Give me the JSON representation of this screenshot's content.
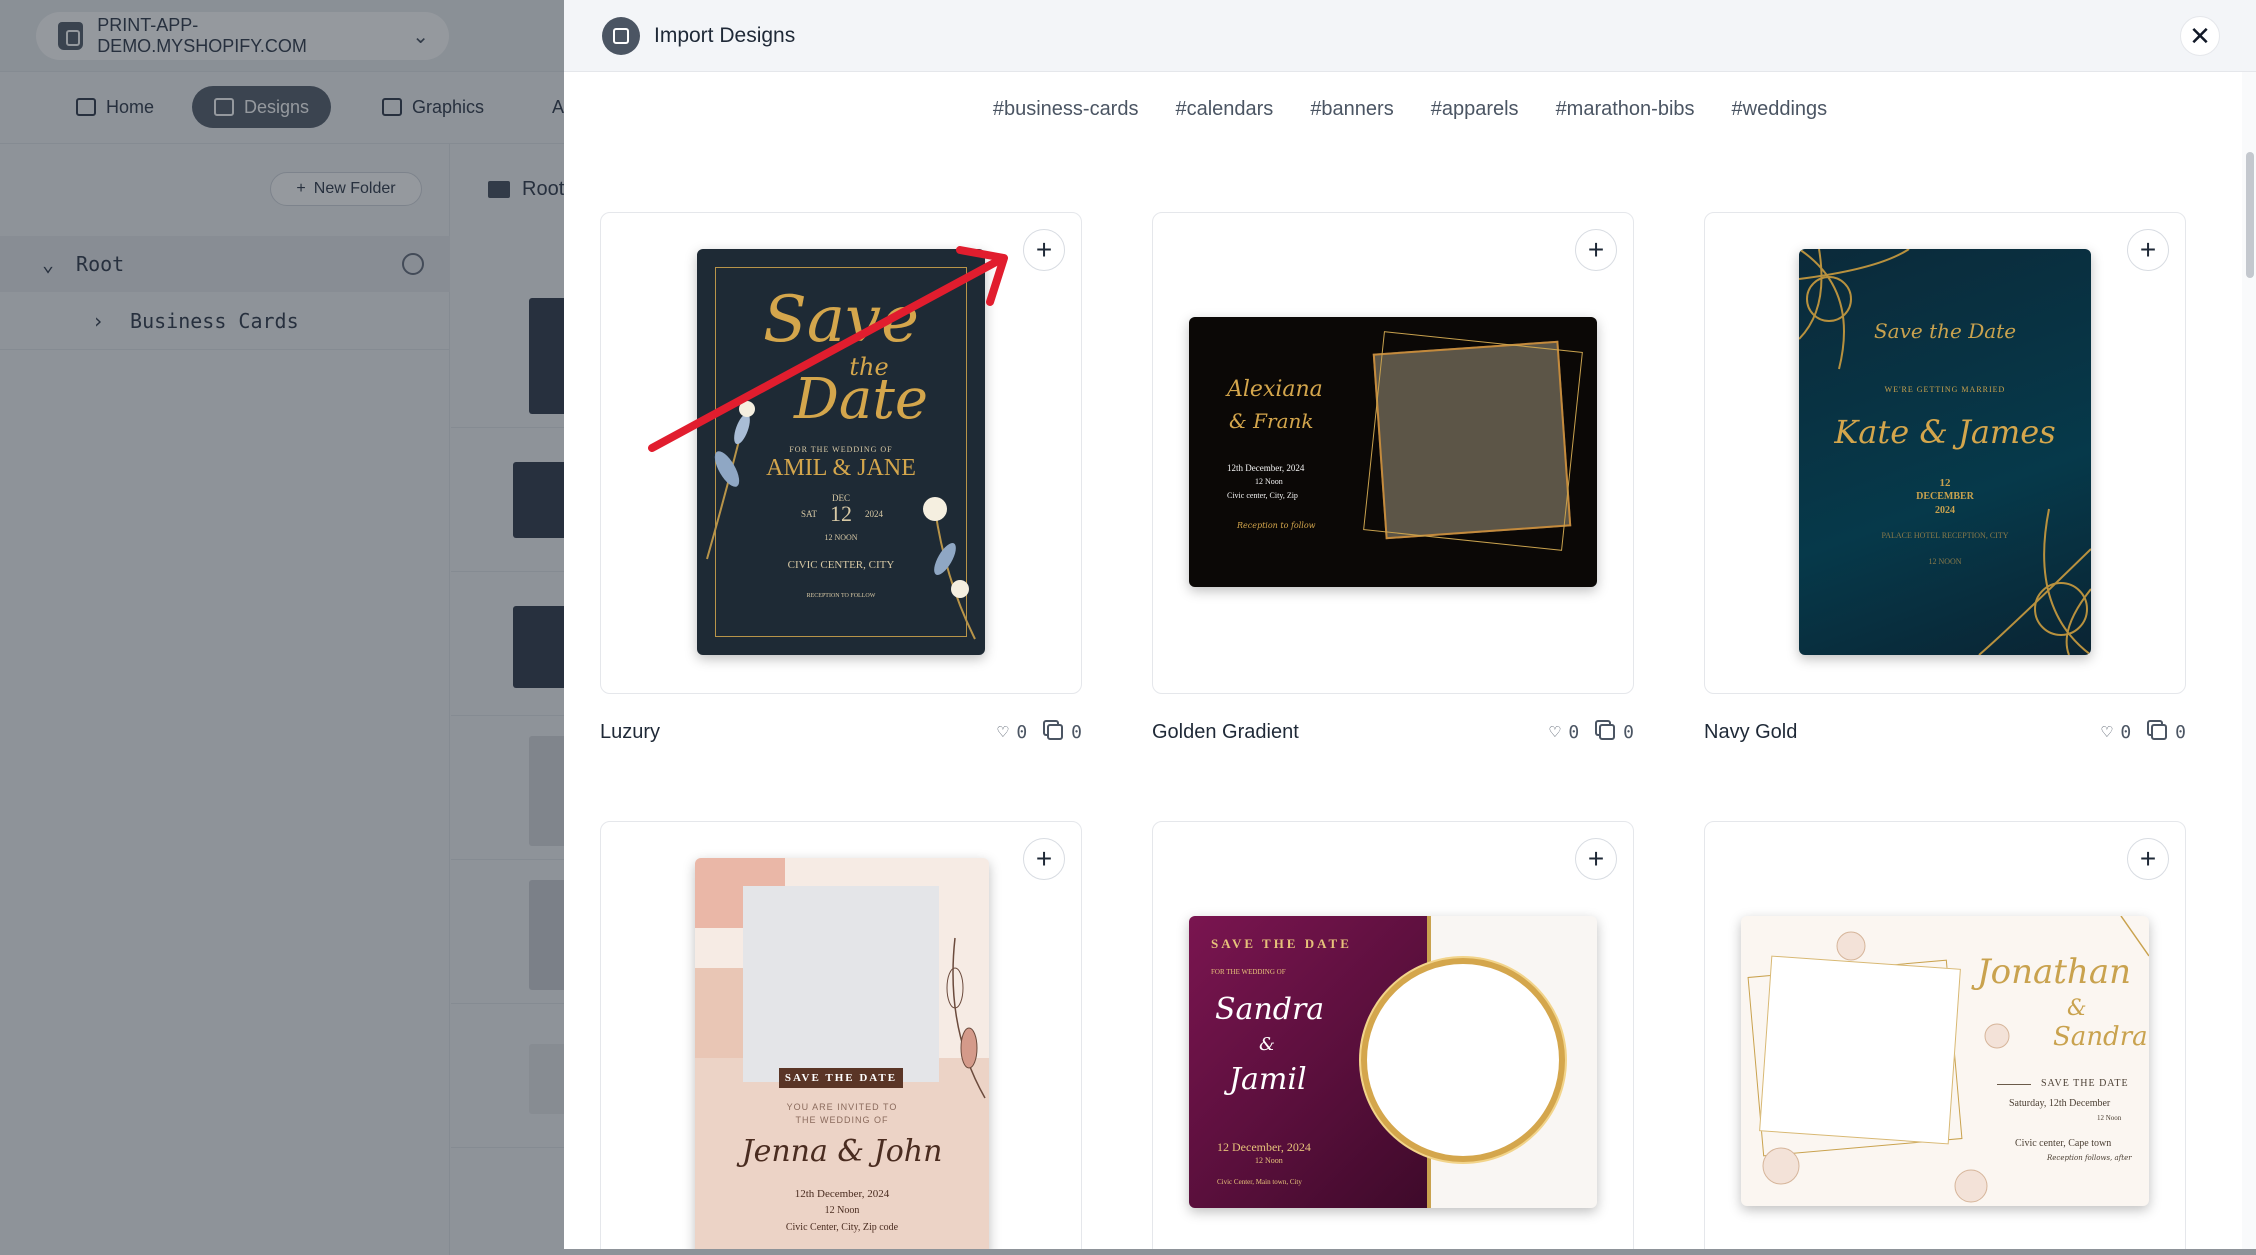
{
  "app": {
    "store_name": "PRINT-APP-DEMO.MYSHOPIFY.COM",
    "nav": [
      {
        "label": "Home"
      },
      {
        "label": "Designs"
      },
      {
        "label": "Graphics"
      },
      {
        "label": "A"
      }
    ],
    "new_folder_label": "New Folder",
    "tree_root_label": "Root",
    "tree_child_label": "Business Cards",
    "breadcrumb_root": "Root"
  },
  "modal": {
    "title": "Import Designs",
    "close_symbol": "✕",
    "tags": [
      "#business-cards",
      "#calendars",
      "#banners",
      "#apparels",
      "#marathon-bibs",
      "#weddings"
    ],
    "add_symbol": "+",
    "designs": [
      {
        "name": "Luzury",
        "likes": "0",
        "copies": "0",
        "art": {
          "title_top": "Save",
          "title_mid": "the",
          "title_bottom": "Date",
          "for_line": "FOR THE WEDDING OF",
          "couple": "AMIL & JANE",
          "day": "SAT",
          "month": "DEC",
          "date": "12",
          "year": "2024",
          "time": "12 NOON",
          "venue": "CIVIC CENTER, CITY",
          "reception": "RECEPTION TO FOLLOW"
        }
      },
      {
        "name": "Golden Gradient",
        "likes": "0",
        "copies": "0",
        "art": {
          "name1": "Alexiana",
          "name2": "& Frank",
          "date": "12th December, 2024",
          "time": "12 Noon",
          "venue": "Civic center, City, Zip",
          "reception": "Reception to follow"
        }
      },
      {
        "name": "Navy Gold",
        "likes": "0",
        "copies": "0",
        "art": {
          "title": "Save the Date",
          "sub": "WE'RE GETTING MARRIED",
          "couple": "Kate & James",
          "day": "12",
          "month": "DECEMBER",
          "year": "2024",
          "venue": "PALACE HOTEL RECEPTION, CITY",
          "time": "12 NOON"
        }
      },
      {
        "art": {
          "banner": "SAVE THE DATE",
          "invite1": "YOU ARE INVITED TO",
          "invite2": "THE WEDDING OF",
          "couple": "Jenna & John",
          "date": "12th December, 2024",
          "time": "12 Noon",
          "venue": "Civic Center, City, Zip code"
        }
      },
      {
        "art": {
          "title": "SAVE THE DATE",
          "for_line": "FOR THE WEDDING OF",
          "name1": "Sandra",
          "amp": "&",
          "name2": "Jamil",
          "date": "12 December, 2024",
          "time": "12 Noon",
          "venue": "Civic Center, Main town, City"
        }
      },
      {
        "art": {
          "name1": "Jonathan",
          "amp": "&",
          "name2": "Sandra",
          "title": "SAVE THE DATE",
          "date": "Saturday, 12th December",
          "time": "12 Noon",
          "venue": "Civic center, Cape town",
          "reception": "Reception follows, after"
        }
      }
    ]
  },
  "colors": {
    "accent_dark": "#5b6472",
    "annotation_arrow": "#e11d2e",
    "gold": "#c9a24e"
  }
}
